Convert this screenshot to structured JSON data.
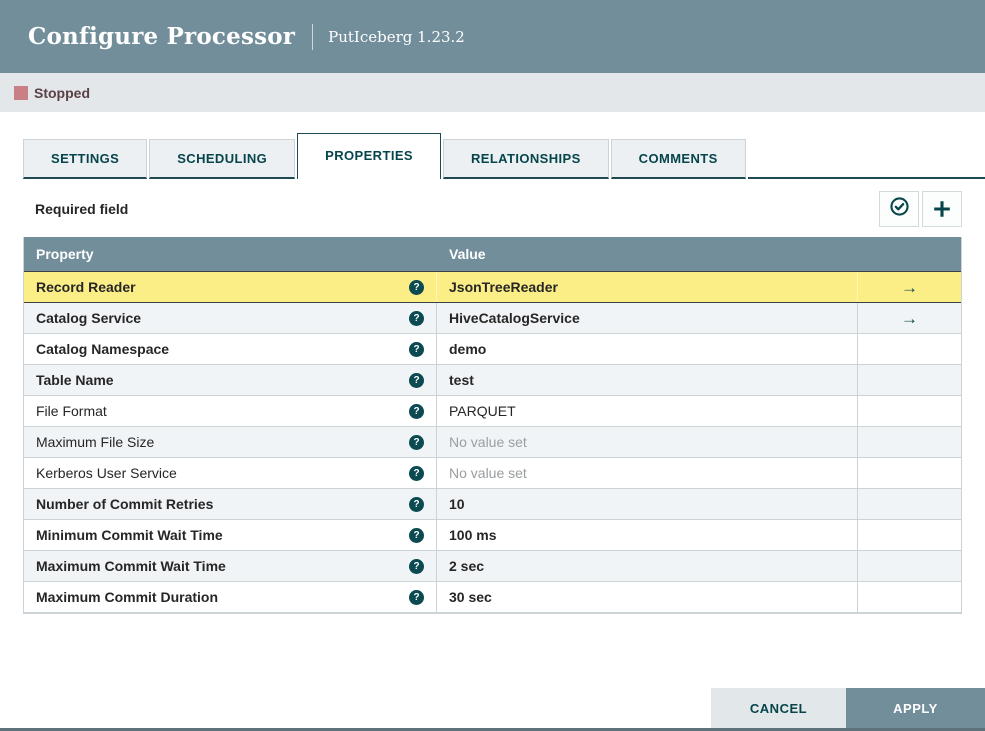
{
  "header": {
    "title": "Configure Processor",
    "subtitle": "PutIceberg 1.23.2"
  },
  "status": {
    "label": "Stopped",
    "square_color": "#c97f86"
  },
  "tabs": [
    {
      "label": "SETTINGS",
      "active": false
    },
    {
      "label": "SCHEDULING",
      "active": false
    },
    {
      "label": "PROPERTIES",
      "active": true
    },
    {
      "label": "RELATIONSHIPS",
      "active": false
    },
    {
      "label": "COMMENTS",
      "active": false
    }
  ],
  "properties_panel": {
    "required_hint": "Required field",
    "toolbar_icons": [
      {
        "name": "verify-properties-icon",
        "glyph": "check-circle"
      },
      {
        "name": "add-property-icon",
        "glyph": "plus"
      }
    ],
    "table": {
      "columns": [
        "Property",
        "Value"
      ],
      "rows": [
        {
          "property": "Record Reader",
          "value": "JsonTreeReader",
          "required": true,
          "empty": false,
          "selected": true,
          "has_goto": true
        },
        {
          "property": "Catalog Service",
          "value": "HiveCatalogService",
          "required": true,
          "empty": false,
          "selected": false,
          "has_goto": true
        },
        {
          "property": "Catalog Namespace",
          "value": "demo",
          "required": true,
          "empty": false,
          "selected": false,
          "has_goto": false
        },
        {
          "property": "Table Name",
          "value": "test",
          "required": true,
          "empty": false,
          "selected": false,
          "has_goto": false
        },
        {
          "property": "File Format",
          "value": "PARQUET",
          "required": false,
          "empty": false,
          "selected": false,
          "has_goto": false
        },
        {
          "property": "Maximum File Size",
          "value": "No value set",
          "required": false,
          "empty": true,
          "selected": false,
          "has_goto": false
        },
        {
          "property": "Kerberos User Service",
          "value": "No value set",
          "required": false,
          "empty": true,
          "selected": false,
          "has_goto": false
        },
        {
          "property": "Number of Commit Retries",
          "value": "10",
          "required": true,
          "empty": false,
          "selected": false,
          "has_goto": false
        },
        {
          "property": "Minimum Commit Wait Time",
          "value": "100 ms",
          "required": true,
          "empty": false,
          "selected": false,
          "has_goto": false
        },
        {
          "property": "Maximum Commit Wait Time",
          "value": "2 sec",
          "required": true,
          "empty": false,
          "selected": false,
          "has_goto": false
        },
        {
          "property": "Maximum Commit Duration",
          "value": "30 sec",
          "required": true,
          "empty": false,
          "selected": false,
          "has_goto": false
        }
      ]
    }
  },
  "footer": {
    "cancel_label": "CANCEL",
    "apply_label": "APPLY"
  },
  "colors": {
    "header_bg": "#728e9b",
    "accent_teal": "#06454c",
    "selected_row": "#fcee87",
    "stripe_row": "#f1f4f6",
    "stopped_square": "#c97f86",
    "apply_bg": "#728e9b"
  }
}
